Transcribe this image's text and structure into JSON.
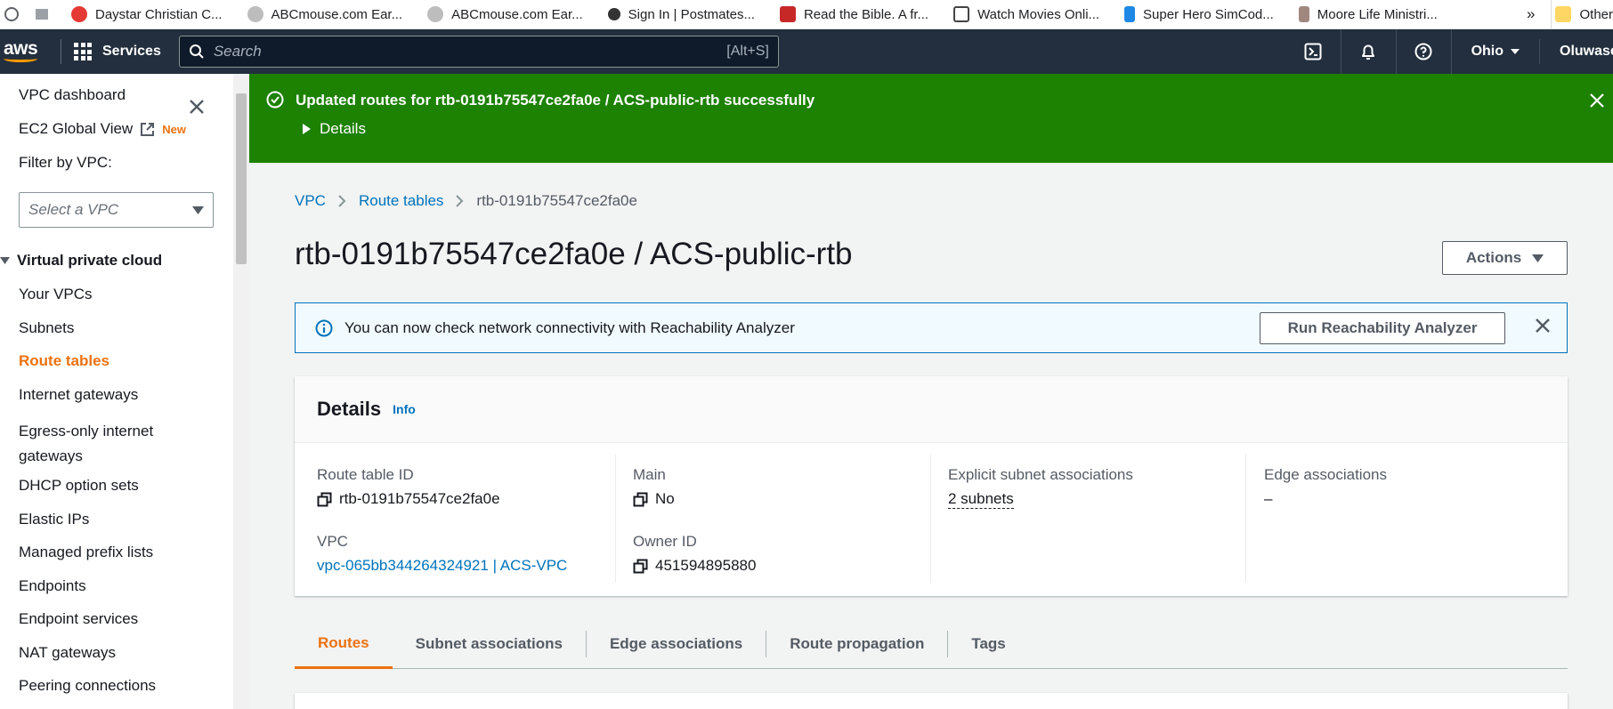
{
  "bookmarks": [
    {
      "label": "Daystar Christian C...",
      "color": "#e53935"
    },
    {
      "label": "ABCmouse.com Ear...",
      "color": "#9e9e9e"
    },
    {
      "label": "ABCmouse.com Ear...",
      "color": "#9e9e9e"
    },
    {
      "label": "Sign In | Postmates...",
      "color": "#333333"
    },
    {
      "label": "Read the Bible. A fr...",
      "color": "#c62828"
    },
    {
      "label": "Watch Movies Onli...",
      "color": "#444444"
    },
    {
      "label": "Super Hero SimCod...",
      "color": "#1e88e5"
    },
    {
      "label": "Moore Life Ministri...",
      "color": "#a1887f"
    }
  ],
  "bookmarks_more": "»",
  "other_bookmarks": "Other",
  "topnav": {
    "services": "Services",
    "search_placeholder": "Search",
    "search_shortcut": "[Alt+S]",
    "region": "Ohio",
    "user": "Oluwase"
  },
  "sidebar": {
    "dashboard": "VPC dashboard",
    "ec2_global": "EC2 Global View",
    "new_badge": "New",
    "filter_label": "Filter by VPC:",
    "filter_placeholder": "Select a VPC",
    "section": "Virtual private cloud",
    "items": [
      "Your VPCs",
      "Subnets",
      "Route tables",
      "Internet gateways",
      "Egress-only internet gateways",
      "DHCP option sets",
      "Elastic IPs",
      "Managed prefix lists",
      "Endpoints",
      "Endpoint services",
      "NAT gateways",
      "Peering connections"
    ],
    "active_item": "Route tables"
  },
  "flash": {
    "message": "Updated routes for rtb-0191b75547ce2fa0e / ACS-public-rtb successfully",
    "details": "Details",
    "color": "#1d8102"
  },
  "breadcrumb": [
    "VPC",
    "Route tables",
    "rtb-0191b75547ce2fa0e"
  ],
  "page_title": "rtb-0191b75547ce2fa0e / ACS-public-rtb",
  "actions_label": "Actions",
  "info_banner": {
    "text": "You can now check network connectivity with Reachability Analyzer",
    "button": "Run Reachability Analyzer"
  },
  "details": {
    "title": "Details",
    "info": "Info",
    "route_table_id_label": "Route table ID",
    "route_table_id": "rtb-0191b75547ce2fa0e",
    "vpc_label": "VPC",
    "vpc_value": "vpc-065bb344264324921 | ACS-VPC",
    "main_label": "Main",
    "main_value": "No",
    "owner_label": "Owner ID",
    "owner_value": "451594895880",
    "explicit_label": "Explicit subnet associations",
    "explicit_value": "2 subnets",
    "edge_label": "Edge associations",
    "edge_value": "–"
  },
  "tabs": [
    "Routes",
    "Subnet associations",
    "Edge associations",
    "Route propagation",
    "Tags"
  ],
  "active_tab": "Routes"
}
